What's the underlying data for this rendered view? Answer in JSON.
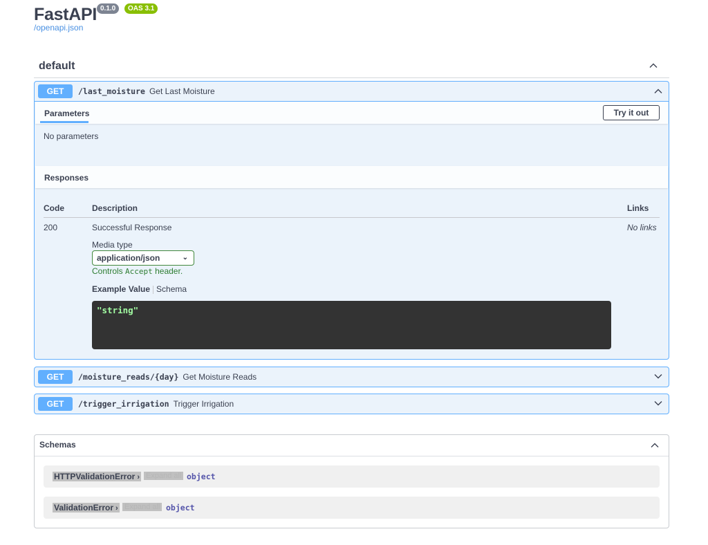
{
  "header": {
    "app_title": "FastAPI",
    "version_badge": "0.1.0",
    "oas_badge": "OAS 3.1",
    "spec_link": "/openapi.json"
  },
  "tag": {
    "title": "default"
  },
  "operations": [
    {
      "method": "GET",
      "path": "/last_moisture",
      "summary": "Get Last Moisture",
      "expanded": true,
      "parameters_title": "Parameters",
      "try_button": "Try it out",
      "no_params": "No parameters",
      "responses_title": "Responses",
      "columns": {
        "code": "Code",
        "description": "Description",
        "links": "Links"
      },
      "response": {
        "code": "200",
        "description": "Successful Response",
        "links": "No links",
        "media_label": "Media type",
        "media_value": "application/json",
        "accept_prefix": "Controls ",
        "accept_code": "Accept",
        "accept_suffix": " header.",
        "example_tab": "Example Value",
        "schema_tab": "Schema",
        "example_code": "\"string\""
      }
    },
    {
      "method": "GET",
      "path": "/moisture_reads/{day}",
      "summary": "Get Moisture Reads",
      "expanded": false
    },
    {
      "method": "GET",
      "path": "/trigger_irrigation",
      "summary": "Trigger Irrigation",
      "expanded": false
    }
  ],
  "schemas": {
    "title": "Schemas",
    "models": [
      {
        "name": "HTTPValidationError",
        "expand": "Expand all",
        "type": "object"
      },
      {
        "name": "ValidationError",
        "expand": "Expand all",
        "type": "object"
      }
    ]
  },
  "colors": {
    "get": "#61affe",
    "get_bg": "#ebf3fb",
    "accept_green": "#2e7d32",
    "code_bg": "#333333",
    "code_text": "#a2fca2"
  },
  "icons": [
    "chevron-up-icon",
    "chevron-down-icon",
    "select-caret-icon",
    "chevron-right-icon"
  ]
}
